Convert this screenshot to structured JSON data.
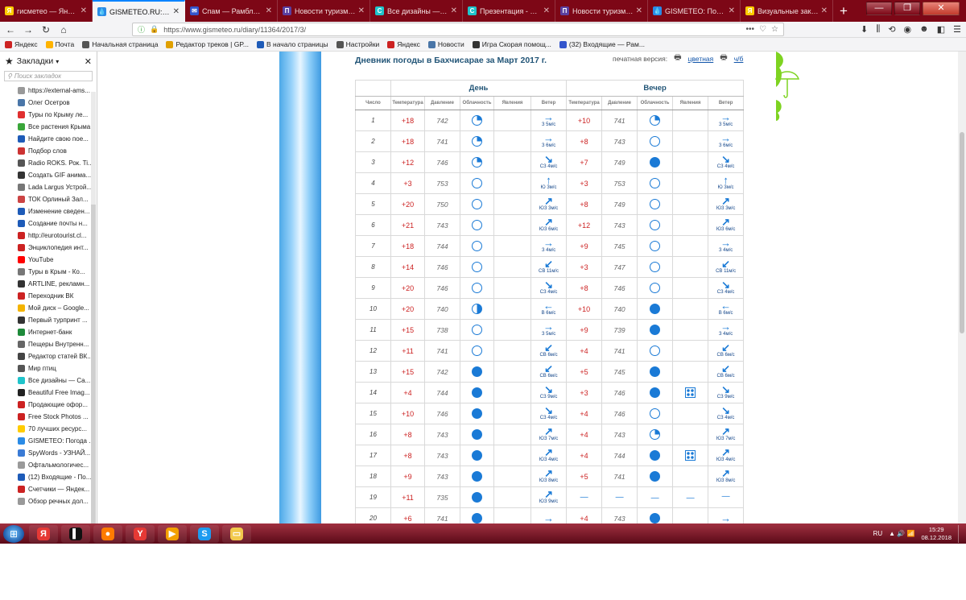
{
  "tabs": [
    {
      "title": "гисметео — Яндекс: н",
      "favicon": "Я",
      "color": "#ffcc00",
      "active": false
    },
    {
      "title": "GISMETEO.RU: Gismeteo",
      "favicon": "💧",
      "color": "#2a8be6",
      "active": true
    },
    {
      "title": "Спам — Рамблер/по",
      "favicon": "✉",
      "color": "#3355cc",
      "active": false
    },
    {
      "title": "Новости туризма - кр",
      "favicon": "П",
      "color": "#5a3fa0",
      "active": false
    },
    {
      "title": "Все дизайны — Canva",
      "favicon": "C",
      "color": "#20c4cb",
      "active": false
    },
    {
      "title": "Презентация - С 8 Ма",
      "favicon": "C",
      "color": "#20c4cb",
      "active": false
    },
    {
      "title": "Новости туризма - кр",
      "favicon": "П",
      "color": "#5a3fa0",
      "active": false
    },
    {
      "title": "GISMETEO: Погода в",
      "favicon": "💧",
      "color": "#2a8be6",
      "active": false
    },
    {
      "title": "Визуальные закладки",
      "favicon": "Я",
      "color": "#ffcc00",
      "active": false
    }
  ],
  "new_tab_label": "+",
  "window_controls": {
    "minimize": "—",
    "maximize": "❐",
    "close": "✕"
  },
  "url": "https://www.gismeteo.ru/diary/11364/2017/3/",
  "url_buttons": [
    "•••",
    "♡",
    "☆"
  ],
  "bookmarks": [
    {
      "label": "Яндекс",
      "color": "#cc2222"
    },
    {
      "label": "Почта",
      "color": "#ffb300"
    },
    {
      "label": "Начальная страница",
      "color": "#555555"
    },
    {
      "label": "Редактор треков | GP...",
      "color": "#e0a000"
    },
    {
      "label": "В начало страницы",
      "color": "#1e5bb8"
    },
    {
      "label": "Настройки",
      "color": "#555555"
    },
    {
      "label": "Яндекс",
      "color": "#cc2222"
    },
    {
      "label": "Новости",
      "color": "#4a76a8"
    },
    {
      "label": "Игра Скорая помощ...",
      "color": "#333333"
    },
    {
      "label": "(32) Входящие — Рам...",
      "color": "#3355cc"
    }
  ],
  "sidebar": {
    "title": "Закладки",
    "search_placeholder": "Поиск закладок",
    "items": [
      {
        "label": "https://external-ams...",
        "color": "#999999"
      },
      {
        "label": "Олег Осетров",
        "color": "#4a76a8"
      },
      {
        "label": "Туры по Крыму ле...",
        "color": "#e03030"
      },
      {
        "label": "Все растения Крыма",
        "color": "#3aa63a"
      },
      {
        "label": "Найдите свою пое...",
        "color": "#1e5bb8"
      },
      {
        "label": "Подбор слов",
        "color": "#cc3333"
      },
      {
        "label": "Radio ROKS. Рок. Ti...",
        "color": "#555555"
      },
      {
        "label": "Создать GIF анима...",
        "color": "#333333"
      },
      {
        "label": "Lada Largus Устрой...",
        "color": "#777777"
      },
      {
        "label": "ТОК Орлиный Зал...",
        "color": "#cc4444"
      },
      {
        "label": "Изменение сведен...",
        "color": "#1e5bb8"
      },
      {
        "label": "Создание почты н...",
        "color": "#1e5bb8"
      },
      {
        "label": "http://eurotourist.cl...",
        "color": "#cc2222"
      },
      {
        "label": "Энциклопедия инт...",
        "color": "#cc2222"
      },
      {
        "label": "YouTube",
        "color": "#ff0000"
      },
      {
        "label": "Туры в Крым - Ко...",
        "color": "#777777"
      },
      {
        "label": "ARTLINE, рекламн...",
        "color": "#333333"
      },
      {
        "label": "Переходник ВК",
        "color": "#cc2222"
      },
      {
        "label": "Мой диск – Google...",
        "color": "#f4b400"
      },
      {
        "label": "Первый турпринт ...",
        "color": "#333333"
      },
      {
        "label": "Интернет-банк",
        "color": "#1e8a3a"
      },
      {
        "label": "Пещеры Внутренн...",
        "color": "#666666"
      },
      {
        "label": "Редактор статей ВК...",
        "color": "#444444"
      },
      {
        "label": "Мир птиц",
        "color": "#555555"
      },
      {
        "label": "Все дизайны — Ca...",
        "color": "#20c4cb"
      },
      {
        "label": "Beautiful Free Imag...",
        "color": "#222222"
      },
      {
        "label": "Продающие офор...",
        "color": "#cc2222"
      },
      {
        "label": "Free Stock Photos ...",
        "color": "#cc2222"
      },
      {
        "label": "70 лучших ресурс...",
        "color": "#ffcc00"
      },
      {
        "label": "GISMETEO: Погода ...",
        "color": "#2a8be6"
      },
      {
        "label": "SpyWords - УЗНАЙ...",
        "color": "#3a7bd5"
      },
      {
        "label": "Офтальмологичес...",
        "color": "#9a9a9a"
      },
      {
        "label": "(12) Входящие - По...",
        "color": "#1e5bb8"
      },
      {
        "label": "Счетчики — Яндек...",
        "color": "#cc2222"
      },
      {
        "label": "Обзор речных дол...",
        "color": "#999999"
      }
    ]
  },
  "page": {
    "title": "Дневник погоды в Бахчисарае за Март 2017 г.",
    "print_label": "печатная версия:",
    "print_color": "цветная",
    "print_bw": "ч/б",
    "group_day": "День",
    "group_evening": "Вечер",
    "col_number": "Число",
    "col_temp": "Температура",
    "col_pressure": "Давление",
    "col_cloud": "Облачность",
    "col_phenomena": "Явления",
    "col_wind": "Ветер"
  },
  "rows": [
    {
      "n": "1",
      "dt": "+18",
      "dp": "742",
      "dc": "c1",
      "dph": "",
      "dwa": "→",
      "dw": "З 5м/с",
      "et": "+10",
      "ep": "741",
      "ec": "c1",
      "eph": "",
      "ewa": "→",
      "ew": "З 5м/с"
    },
    {
      "n": "2",
      "dt": "+18",
      "dp": "741",
      "dc": "c1",
      "dph": "",
      "dwa": "→",
      "dw": "З 6м/с",
      "et": "+8",
      "ep": "743",
      "ec": "c0",
      "eph": "",
      "ewa": "→",
      "ew": "З 6м/с"
    },
    {
      "n": "3",
      "dt": "+12",
      "dp": "746",
      "dc": "c1",
      "dph": "",
      "dwa": "↘",
      "dw": "СЗ 4м/с",
      "et": "+7",
      "ep": "749",
      "ec": "c3",
      "eph": "",
      "ewa": "↘",
      "ew": "СЗ 4м/с"
    },
    {
      "n": "4",
      "dt": "+3",
      "dp": "753",
      "dc": "c0",
      "dph": "",
      "dwa": "↑",
      "dw": "Ю 3м/с",
      "et": "+3",
      "ep": "753",
      "ec": "c0",
      "eph": "",
      "ewa": "↑",
      "ew": "Ю 3м/с"
    },
    {
      "n": "5",
      "dt": "+20",
      "dp": "750",
      "dc": "c0",
      "dph": "",
      "dwa": "↗",
      "dw": "ЮЗ 3м/с",
      "et": "+8",
      "ep": "749",
      "ec": "c0",
      "eph": "",
      "ewa": "↗",
      "ew": "ЮЗ 3м/с"
    },
    {
      "n": "6",
      "dt": "+21",
      "dp": "743",
      "dc": "c0",
      "dph": "",
      "dwa": "↗",
      "dw": "ЮЗ 6м/с",
      "et": "+12",
      "ep": "743",
      "ec": "c0",
      "eph": "",
      "ewa": "↗",
      "ew": "ЮЗ 6м/с"
    },
    {
      "n": "7",
      "dt": "+18",
      "dp": "744",
      "dc": "c0",
      "dph": "",
      "dwa": "→",
      "dw": "З 4м/с",
      "et": "+9",
      "ep": "745",
      "ec": "c0",
      "eph": "",
      "ewa": "→",
      "ew": "З 4м/с"
    },
    {
      "n": "8",
      "dt": "+14",
      "dp": "746",
      "dc": "c0",
      "dph": "",
      "dwa": "↙",
      "dw": "СВ 11м/с",
      "et": "+3",
      "ep": "747",
      "ec": "c0",
      "eph": "",
      "ewa": "↙",
      "ew": "СВ 11м/с"
    },
    {
      "n": "9",
      "dt": "+20",
      "dp": "746",
      "dc": "c0",
      "dph": "",
      "dwa": "↘",
      "dw": "СЗ 4м/с",
      "et": "+8",
      "ep": "746",
      "ec": "c0",
      "eph": "",
      "ewa": "↘",
      "ew": "СЗ 4м/с"
    },
    {
      "n": "10",
      "dt": "+20",
      "dp": "740",
      "dc": "c2",
      "dph": "",
      "dwa": "←",
      "dw": "В 6м/с",
      "et": "+10",
      "ep": "740",
      "ec": "c3",
      "eph": "",
      "ewa": "←",
      "ew": "В 6м/с"
    },
    {
      "n": "11",
      "dt": "+15",
      "dp": "738",
      "dc": "c0",
      "dph": "",
      "dwa": "→",
      "dw": "З 5м/с",
      "et": "+9",
      "ep": "739",
      "ec": "c3",
      "eph": "",
      "ewa": "→",
      "ew": "З 4м/с"
    },
    {
      "n": "12",
      "dt": "+11",
      "dp": "741",
      "dc": "c0",
      "dph": "",
      "dwa": "↙",
      "dw": "СВ 6м/с",
      "et": "+4",
      "ep": "741",
      "ec": "c0",
      "eph": "",
      "ewa": "↙",
      "ew": "СВ 6м/с"
    },
    {
      "n": "13",
      "dt": "+15",
      "dp": "742",
      "dc": "c3",
      "dph": "",
      "dwa": "↙",
      "dw": "СВ 6м/с",
      "et": "+5",
      "ep": "745",
      "ec": "c3",
      "eph": "",
      "ewa": "↙",
      "ew": "СВ 6м/с"
    },
    {
      "n": "14",
      "dt": "+4",
      "dp": "744",
      "dc": "c3",
      "dph": "",
      "dwa": "↘",
      "dw": "СЗ 9м/с",
      "et": "+3",
      "ep": "746",
      "ec": "c3",
      "eph": "ph",
      "ewa": "↘",
      "ew": "СЗ 9м/с"
    },
    {
      "n": "15",
      "dt": "+10",
      "dp": "746",
      "dc": "c3",
      "dph": "",
      "dwa": "↘",
      "dw": "СЗ 4м/с",
      "et": "+4",
      "ep": "746",
      "ec": "c0",
      "eph": "",
      "ewa": "↘",
      "ew": "СЗ 4м/с"
    },
    {
      "n": "16",
      "dt": "+8",
      "dp": "743",
      "dc": "c3",
      "dph": "",
      "dwa": "↗",
      "dw": "ЮЗ 7м/с",
      "et": "+4",
      "ep": "743",
      "ec": "c1",
      "eph": "",
      "ewa": "↗",
      "ew": "ЮЗ 7м/с"
    },
    {
      "n": "17",
      "dt": "+8",
      "dp": "743",
      "dc": "c3",
      "dph": "",
      "dwa": "↗",
      "dw": "ЮЗ 4м/с",
      "et": "+4",
      "ep": "744",
      "ec": "c3",
      "eph": "ph",
      "ewa": "↗",
      "ew": "ЮЗ 4м/с"
    },
    {
      "n": "18",
      "dt": "+9",
      "dp": "743",
      "dc": "c3",
      "dph": "",
      "dwa": "↗",
      "dw": "ЮЗ 8м/с",
      "et": "+5",
      "ep": "741",
      "ec": "c3",
      "eph": "",
      "ewa": "↗",
      "ew": "ЮЗ 8м/с"
    },
    {
      "n": "19",
      "dt": "+11",
      "dp": "735",
      "dc": "c3",
      "dph": "",
      "dwa": "↗",
      "dw": "ЮЗ 9м/с",
      "et": "—",
      "ep": "—",
      "ec": "dash",
      "eph": "—",
      "ewa": "",
      "ew": "—"
    },
    {
      "n": "20",
      "dt": "+6",
      "dp": "741",
      "dc": "c3",
      "dph": "",
      "dwa": "→",
      "dw": "",
      "et": "+4",
      "ep": "743",
      "ec": "c3",
      "eph": "",
      "ewa": "→",
      "ew": ""
    }
  ],
  "taskbar": {
    "apps": [
      {
        "label": "Я",
        "color": "#e53935"
      },
      {
        "label": "▌",
        "color": "#111111"
      },
      {
        "label": "●",
        "color": "#ff7b00"
      },
      {
        "label": "Y",
        "color": "#e53935"
      },
      {
        "label": "▶",
        "color": "#f3a000"
      },
      {
        "label": "S",
        "color": "#1d9bf0"
      },
      {
        "label": "▭",
        "color": "#f2c94c"
      }
    ],
    "lang": "RU",
    "tray_icons": "▲ 🔊 📶",
    "time": "15:29",
    "date": "08.12.2018"
  }
}
